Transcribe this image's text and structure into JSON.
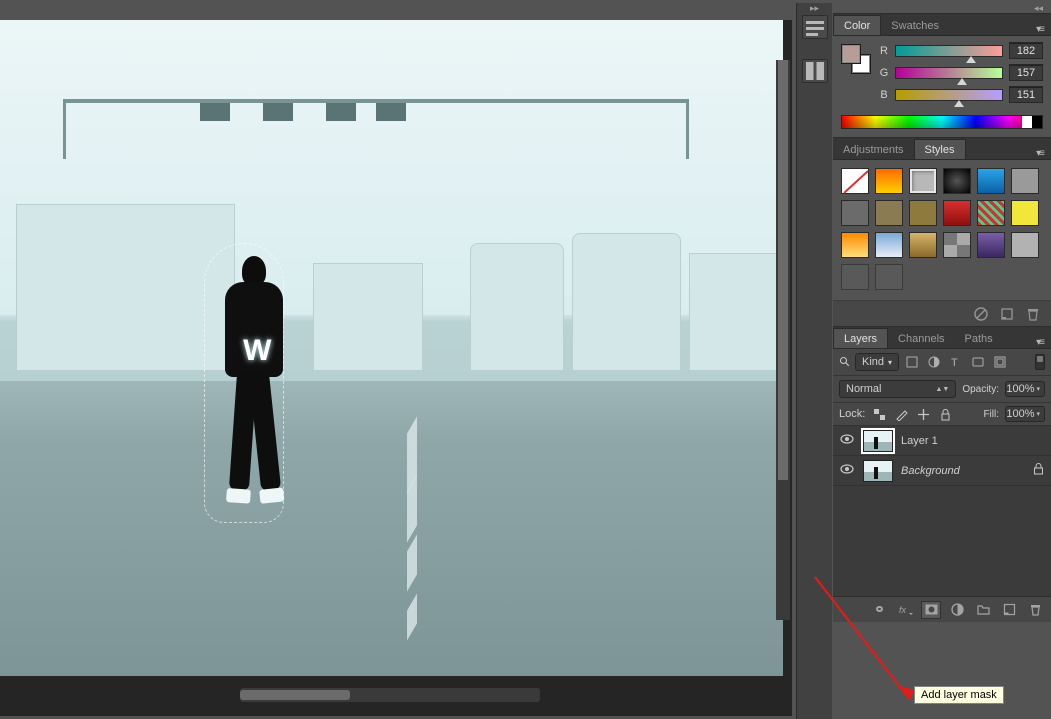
{
  "color_panel": {
    "tabs": [
      "Color",
      "Swatches"
    ],
    "active_tab": "Color",
    "channels": [
      {
        "label": "R",
        "value": "182",
        "pct": 71
      },
      {
        "label": "G",
        "value": "157",
        "pct": 62
      },
      {
        "label": "B",
        "value": "151",
        "pct": 59
      }
    ],
    "fg": "#b69d97",
    "bg": "#ffffff"
  },
  "styles_panel": {
    "tabs": [
      "Adjustments",
      "Styles"
    ],
    "active_tab": "Styles",
    "swatches": [
      {
        "bg": "#fff",
        "overlay": "none",
        "name": "no-style",
        "type": "diag"
      },
      {
        "bg": "linear-gradient(#ff6a00,#ffd000)",
        "name": "orange-gradient"
      },
      {
        "bg": "#b8b8b8",
        "name": "bevel-gray",
        "sel": true,
        "box": true
      },
      {
        "bg": "radial-gradient(#555,#000)",
        "name": "vignette"
      },
      {
        "bg": "linear-gradient(#2aa4e8,#0b61a4)",
        "name": "blue-gradient"
      },
      {
        "bg": "#9a9a9a",
        "name": "flat-gray"
      },
      {
        "bg": "#6b6b6b",
        "name": "metal-dark"
      },
      {
        "bg": "#8a7b52",
        "name": "bronze"
      },
      {
        "bg": "#8f7a3e",
        "name": "gold-dark"
      },
      {
        "bg": "linear-gradient(#d83030,#8e0f0f)",
        "name": "red-gradient"
      },
      {
        "bg": "repeating-linear-gradient(45deg,#c33,#c33 3px,#5c8 3px,#5c8 6px)",
        "name": "stripes"
      },
      {
        "bg": "#f2e63a",
        "name": "yellow"
      },
      {
        "bg": "linear-gradient(#ff8a00,#ffde7a)",
        "name": "sunset"
      },
      {
        "bg": "linear-gradient(#7aa9d6,#e6eef6)",
        "name": "sky"
      },
      {
        "bg": "linear-gradient(#d6b46b,#8a6a2a)",
        "name": "wood"
      },
      {
        "bg": "repeating-conic-gradient(#aaa 0 25%,#777 0 50%)",
        "name": "checks"
      },
      {
        "bg": "linear-gradient(#7a5ea8,#3a2760)",
        "name": "purple"
      },
      {
        "bg": "#b2b2b2",
        "name": "blank-gray"
      },
      {
        "bg": "#595959",
        "name": "empty1",
        "empty": true
      },
      {
        "bg": "#595959",
        "name": "empty2",
        "empty": true
      }
    ]
  },
  "layers_panel": {
    "tabs": [
      "Layers",
      "Channels",
      "Paths"
    ],
    "active_tab": "Layers",
    "filter": {
      "kind_label": "Kind"
    },
    "blend": {
      "mode": "Normal",
      "opacity_label": "Opacity:",
      "opacity_value": "100%"
    },
    "lock": {
      "label": "Lock:",
      "fill_label": "Fill:",
      "fill_value": "100%"
    },
    "layers": [
      {
        "name": "Layer 1",
        "visible": true,
        "selected": true,
        "locked": false
      },
      {
        "name": "Background",
        "visible": true,
        "selected": false,
        "locked": true,
        "bg": true
      }
    ],
    "footer_tooltip": "Add layer mask"
  },
  "icons": {
    "search": "search-icon",
    "menu": "flyout-menu-icon"
  }
}
